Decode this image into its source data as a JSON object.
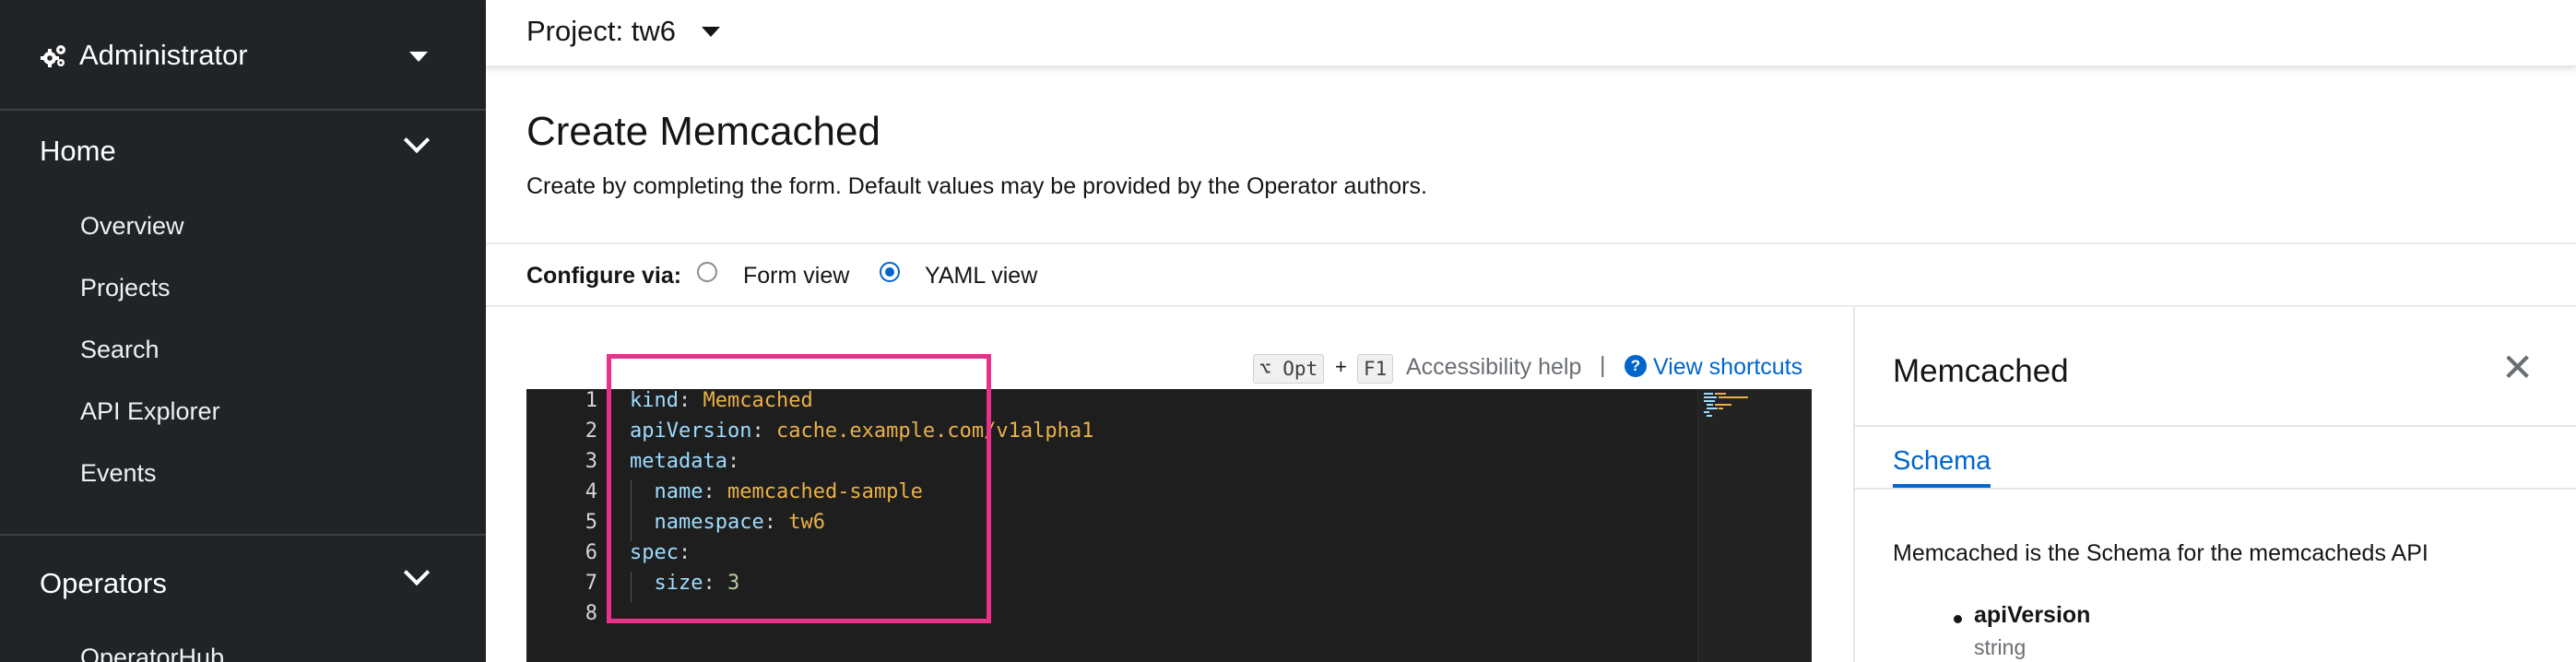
{
  "sidebar": {
    "perspective": {
      "label": "Administrator",
      "icon": "cogs-icon"
    },
    "home": {
      "label": "Home",
      "items": [
        "Overview",
        "Projects",
        "Search",
        "API Explorer",
        "Events"
      ]
    },
    "operators": {
      "label": "Operators",
      "items": [
        "OperatorHub"
      ]
    }
  },
  "project_bar": {
    "label": "Project: tw6"
  },
  "page": {
    "title": "Create Memcached",
    "description": "Create by completing the form. Default values may be provided by the Operator authors.",
    "configure_label": "Configure via:",
    "options": [
      {
        "label": "Form view",
        "selected": false
      },
      {
        "label": "YAML view",
        "selected": true
      }
    ]
  },
  "editor_toolbar": {
    "key1": "⌥ Opt",
    "plus": "+",
    "key2": "F1",
    "accessibility": "Accessibility help",
    "separator": "|",
    "shortcuts": "View shortcuts"
  },
  "yaml": {
    "line_numbers": [
      "1",
      "2",
      "3",
      "4",
      "5",
      "6",
      "7",
      "8"
    ],
    "lines": [
      {
        "key": "kind",
        "value": "Memcached"
      },
      {
        "key": "apiVersion",
        "value": "cache.example.com/v1alpha1"
      },
      {
        "key": "metadata",
        "value": ""
      },
      {
        "key": "name",
        "value": "memcached-sample"
      },
      {
        "key": "namespace",
        "value": "tw6"
      },
      {
        "key": "spec",
        "value": ""
      },
      {
        "key": "size",
        "value": "3"
      }
    ]
  },
  "schema_panel": {
    "title": "Memcached",
    "close": "✕",
    "tab": "Schema",
    "description": "Memcached is the Schema for the memcacheds API",
    "properties": [
      {
        "name": "apiVersion",
        "type": "string"
      }
    ]
  },
  "colors": {
    "sidebar_bg": "#212427",
    "link": "#0066cc",
    "highlight_box": "#e8318a",
    "code_bg": "#1e1e1e",
    "yaml_key": "#9cdcfe",
    "yaml_string": "#e9b148",
    "yaml_number": "#b5cea8"
  }
}
